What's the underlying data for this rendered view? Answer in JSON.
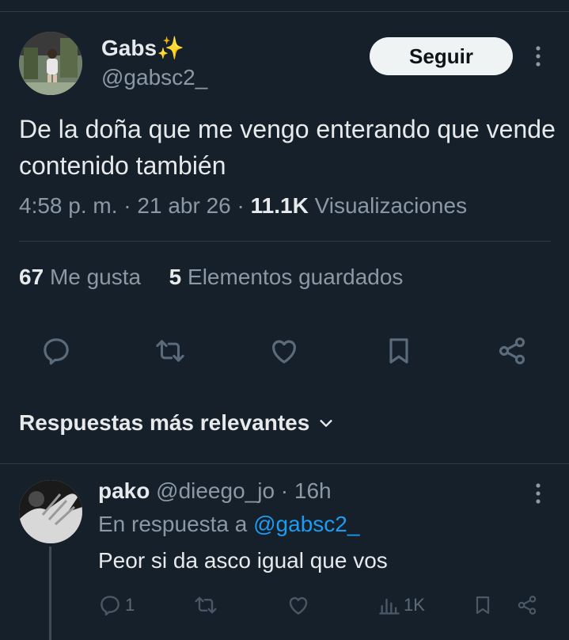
{
  "tweet": {
    "author_name": "Gabs",
    "author_emoji": "✨",
    "author_handle": "@gabsc2_",
    "follow_label": "Seguir",
    "text": "De la doña que me vengo enterando que vende contenido también",
    "time": "4:58 p. m.",
    "date": "21 abr 26",
    "views_count": "11.1K",
    "views_label": "Visualizaciones",
    "likes_count": "67",
    "likes_label": "Me gusta",
    "bookmarks_count": "5",
    "bookmarks_label": "Elementos guardados"
  },
  "sort": {
    "label": "Respuestas más relevantes"
  },
  "reply": {
    "name": "pako",
    "handle": "@dieego_jo",
    "age": "16h",
    "reply_prefix": "En respuesta a",
    "reply_mention": "@gabsc2_",
    "text": "Peor si da asco igual que vos",
    "reply_count": "1",
    "views_count": "1K"
  },
  "icons": {
    "tweet_actions": [
      "reply-icon",
      "retweet-icon",
      "like-icon",
      "bookmark-icon",
      "share-icon"
    ],
    "reply_actions": [
      "reply-icon",
      "retweet-icon",
      "like-icon",
      "views-icon",
      "bookmark-icon",
      "share-icon"
    ]
  },
  "colors": {
    "background": "#15202b",
    "text": "#e7e9ea",
    "muted": "#8b98a5",
    "link": "#1d9bf0",
    "follow_bg": "#eff3f4"
  }
}
